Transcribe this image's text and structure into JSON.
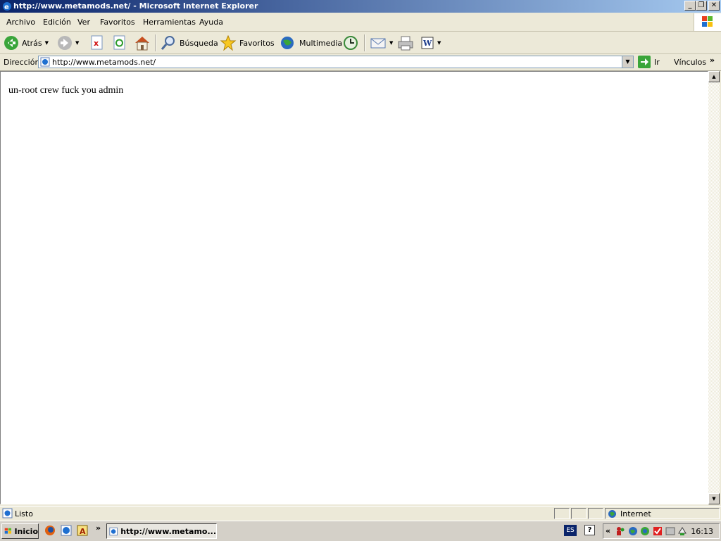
{
  "window": {
    "title": "http://www.metamods.net/ - Microsoft Internet Explorer",
    "controls": [
      "_",
      "❐",
      "✕"
    ]
  },
  "menu": {
    "items": [
      "Archivo",
      "Edición",
      "Ver",
      "Favoritos",
      "Herramientas",
      "Ayuda"
    ]
  },
  "toolbar": {
    "back_label": "Atrás",
    "search_label": "Búsqueda",
    "favorites_label": "Favoritos",
    "media_label": "Multimedia"
  },
  "address": {
    "label": "Dirección",
    "url": "http://www.metamods.net/",
    "go_label": "Ir",
    "links_label": "Vínculos"
  },
  "page": {
    "text": "un-root crew fuck you admin"
  },
  "status": {
    "text": "Listo",
    "zone": "Internet"
  },
  "taskbar": {
    "start_label": "Inicio",
    "task_label": "http://www.metamo...",
    "language": "ES",
    "clock": "16:13"
  }
}
